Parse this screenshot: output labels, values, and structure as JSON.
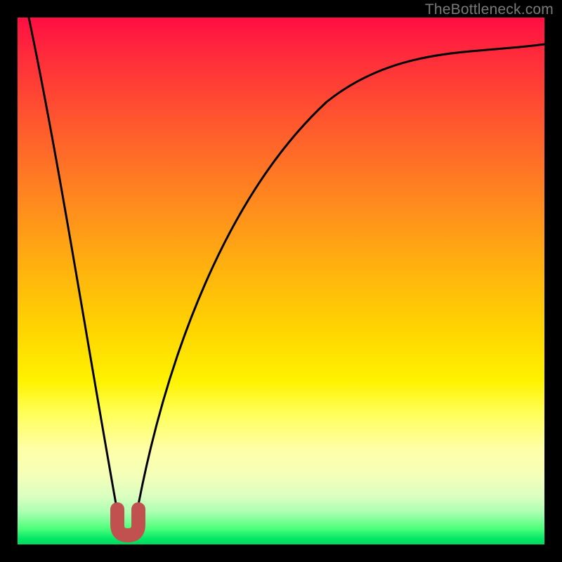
{
  "watermark": {
    "text": "TheBottleneck.com"
  },
  "chart_data": {
    "type": "line",
    "title": "",
    "xlabel": "",
    "ylabel": "",
    "xlim": [
      0,
      1
    ],
    "ylim": [
      0,
      100
    ],
    "background": "heatmap-gradient-vertical",
    "gradient_stops": [
      {
        "pos": 0.0,
        "color": "#ff0e43"
      },
      {
        "pos": 0.3,
        "color": "#ff7a24"
      },
      {
        "pos": 0.6,
        "color": "#ffd700"
      },
      {
        "pos": 0.8,
        "color": "#ffff8a"
      },
      {
        "pos": 1.0,
        "color": "#00d85e"
      }
    ],
    "series": [
      {
        "name": "left-branch",
        "x": [
          0.022,
          0.05,
          0.08,
          0.11,
          0.14,
          0.17,
          0.193
        ],
        "values": [
          100,
          83,
          65,
          47,
          30,
          12,
          0
        ]
      },
      {
        "name": "right-branch",
        "x": [
          0.222,
          0.25,
          0.29,
          0.33,
          0.38,
          0.44,
          0.51,
          0.59,
          0.68,
          0.78,
          0.89,
          1.0
        ],
        "values": [
          0,
          13,
          27,
          39,
          50,
          60,
          69,
          77,
          83,
          88,
          92,
          95
        ]
      }
    ],
    "annotations": [
      {
        "name": "u-marker",
        "shape": "U",
        "color": "#c1514f",
        "x_center": 0.208,
        "y_range": [
          0,
          4
        ],
        "stroke_width_px": 20
      }
    ],
    "legend": null,
    "grid": false
  }
}
